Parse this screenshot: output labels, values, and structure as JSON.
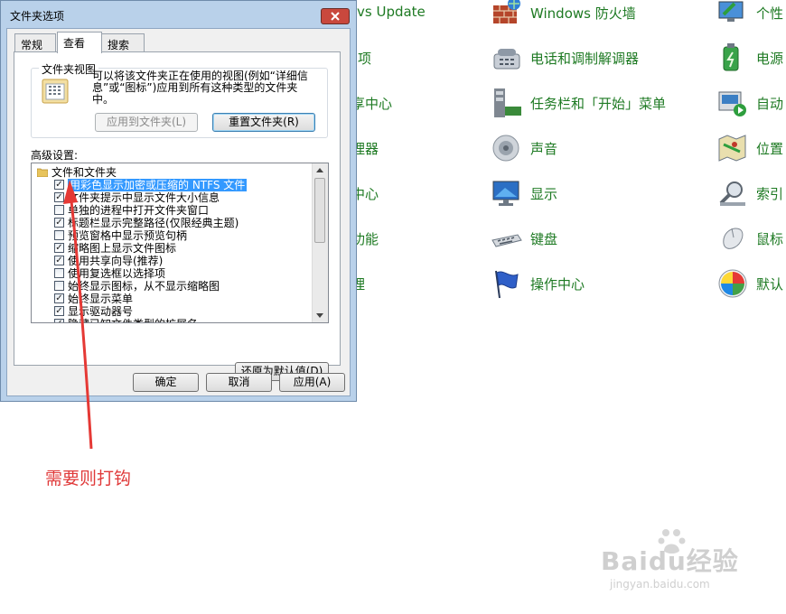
{
  "background": {
    "fragments": [
      {
        "text": "vs Update",
        "pos": "f1"
      },
      {
        "text": "项",
        "pos": "f2"
      },
      {
        "text": "享中心",
        "pos": "f3"
      },
      {
        "text": "理器",
        "pos": "f4"
      },
      {
        "text": "中心",
        "pos": "f5"
      },
      {
        "text": "功能",
        "pos": "f6"
      },
      {
        "text": "理",
        "pos": "f7"
      }
    ],
    "middle": [
      {
        "label": "Windows 防火墙",
        "icon": "firewall-icon"
      },
      {
        "label": "电话和调制解调器",
        "icon": "phone-modem-icon"
      },
      {
        "label": "任务栏和「开始」菜单",
        "icon": "taskbar-icon"
      },
      {
        "label": "声音",
        "icon": "speaker-icon"
      },
      {
        "label": "显示",
        "icon": "display-icon"
      },
      {
        "label": "键盘",
        "icon": "keyboard-icon"
      },
      {
        "label": "操作中心",
        "icon": "flag-icon"
      }
    ],
    "right": [
      {
        "label": "个性",
        "icon": "personalize-icon"
      },
      {
        "label": "电源",
        "icon": "power-icon"
      },
      {
        "label": "自动",
        "icon": "autoplay-icon"
      },
      {
        "label": "位置",
        "icon": "location-icon"
      },
      {
        "label": "索引",
        "icon": "index-icon"
      },
      {
        "label": "鼠标",
        "icon": "mouse-icon"
      },
      {
        "label": "默认",
        "icon": "default-programs-icon"
      }
    ]
  },
  "dialog": {
    "title": "文件夹选项",
    "tabs": [
      "常规",
      "查看",
      "搜索"
    ],
    "active_tab": 1,
    "folder_view": {
      "group_title": "文件夹视图",
      "description": [
        "可以将该文件夹正在使用的视图(例如“详细信",
        "息”或“图标”)应用到所有这种类型的文件夹",
        "中。"
      ],
      "apply_button": "应用到文件夹(L)",
      "reset_button": "重置文件夹(R)"
    },
    "advanced_label": "高级设置:",
    "tree": {
      "root": "文件和文件夹",
      "items": [
        {
          "text": "用彩色显示加密或压缩的 NTFS 文件",
          "checked": true,
          "selected": true
        },
        {
          "text": "文件夹提示中显示文件大小信息",
          "checked": true
        },
        {
          "text": "单独的进程中打开文件夹窗口",
          "checked": false
        },
        {
          "text": "标题栏显示完整路径(仅限经典主题)",
          "checked": true
        },
        {
          "text": "预览窗格中显示预览句柄",
          "checked": false
        },
        {
          "text": "缩略图上显示文件图标",
          "checked": true
        },
        {
          "text": "使用共享向导(推荐)",
          "checked": true
        },
        {
          "text": "使用复选框以选择项",
          "checked": false
        },
        {
          "text": "始终显示图标，从不显示缩略图",
          "checked": false
        },
        {
          "text": "始终显示菜单",
          "checked": true
        },
        {
          "text": "显示驱动器号",
          "checked": true
        },
        {
          "text": "隐藏已知文件类型的扩展名",
          "checked": true
        }
      ]
    },
    "restore_button": "还原为默认值(D)",
    "ok_button": "确定",
    "cancel_button": "取消",
    "apply_button": "应用(A)"
  },
  "annotation": {
    "text": "需要则打钩",
    "color": "#e03a3a"
  },
  "watermark": {
    "brand": "Baidu经验",
    "url": "jingyan.baidu.com"
  }
}
